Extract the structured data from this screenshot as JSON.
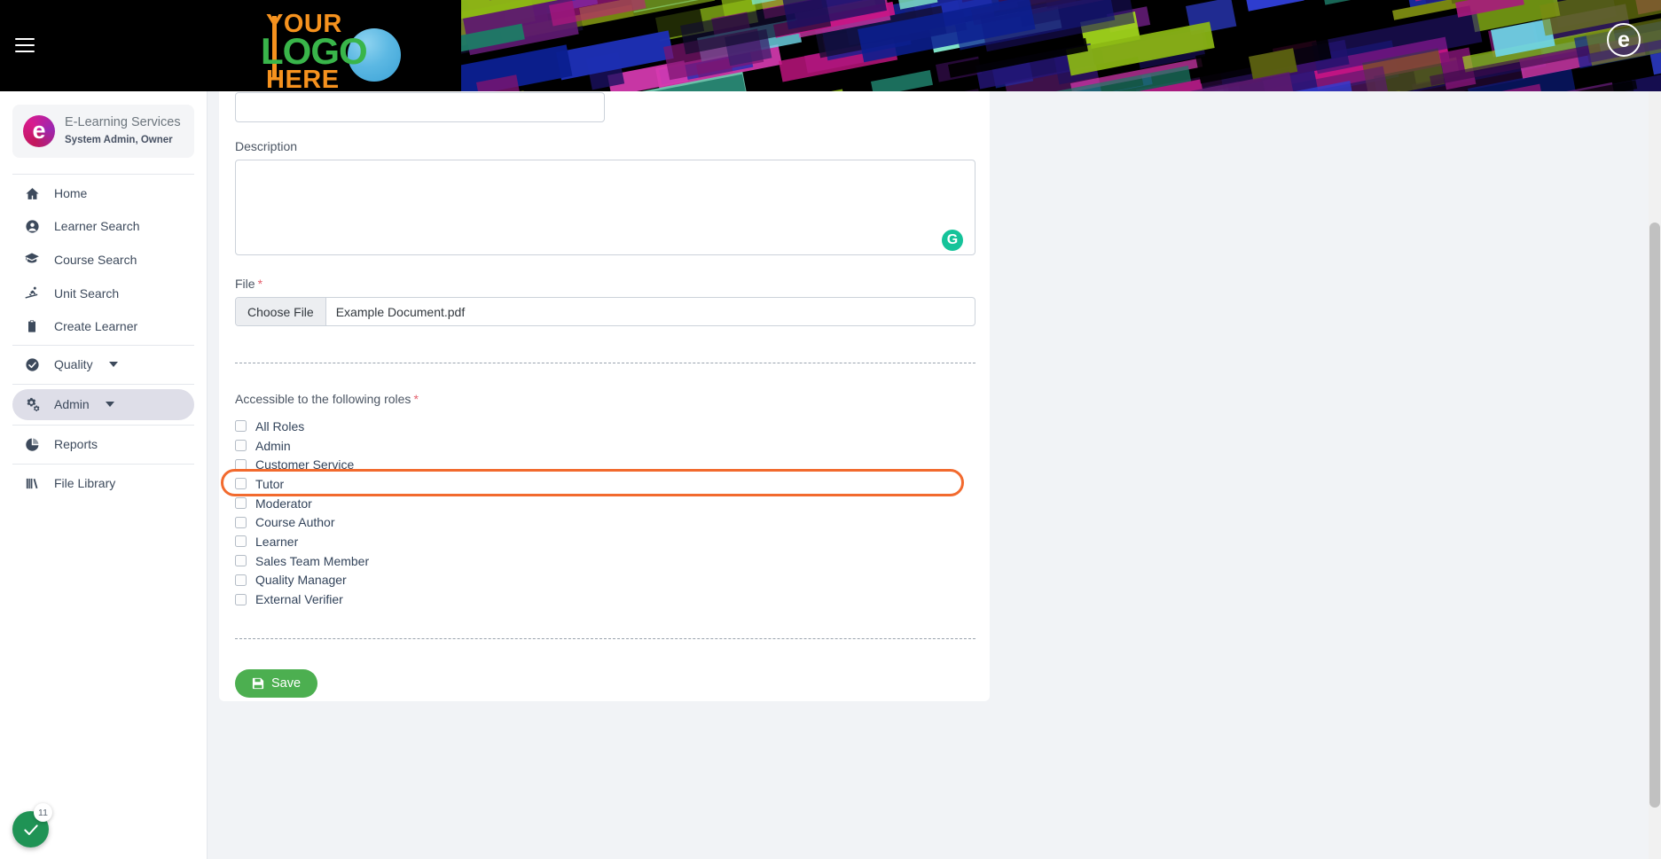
{
  "banner": {
    "menu_icon": "hamburger-menu-icon",
    "logo_line1": "YOUR",
    "logo_line2": "LOGO",
    "logo_line3": "HERE",
    "avatar_letter": "e",
    "bg_color": "#000000",
    "logo_orange": "#f6921e",
    "logo_green": "#39b54a",
    "logo_blue": "#5cb8e3"
  },
  "sidebar": {
    "profile": {
      "avatar_letter": "e",
      "name": "E-Learning Services",
      "role": "System Admin, Owner"
    },
    "items": [
      {
        "label": "Home",
        "icon": "home-icon",
        "has_caret": false,
        "active": false
      },
      {
        "label": "Learner Search",
        "icon": "user-circle-icon",
        "has_caret": false,
        "active": false
      },
      {
        "label": "Course Search",
        "icon": "graduate-icon",
        "has_caret": false,
        "active": false
      },
      {
        "label": "Unit Search",
        "icon": "skier-icon",
        "has_caret": false,
        "active": false
      },
      {
        "label": "Create Learner",
        "icon": "clipboard-list-icon",
        "has_caret": false,
        "active": false
      },
      {
        "label": "Quality",
        "icon": "check-circle-icon",
        "has_caret": true,
        "active": false
      },
      {
        "label": "Admin",
        "icon": "cogs-icon",
        "has_caret": true,
        "active": true
      },
      {
        "label": "Reports",
        "icon": "pie-chart-icon",
        "has_caret": false,
        "active": false
      },
      {
        "label": "File Library",
        "icon": "books-icon",
        "has_caret": false,
        "active": false
      }
    ]
  },
  "form": {
    "title_value": "",
    "title_placeholder": "",
    "description_label": "Description",
    "description_value": "",
    "description_placeholder": "",
    "grammarly_icon": "grammarly-g-icon",
    "file_label": "File",
    "file_required": "*",
    "choose_file_label": "Choose File",
    "file_name": "Example Document.pdf",
    "roles_label": "Accessible to the following roles",
    "roles_required": "*",
    "roles": [
      {
        "label": "All Roles",
        "checked": false
      },
      {
        "label": "Admin",
        "checked": false
      },
      {
        "label": "Customer Service",
        "checked": false
      },
      {
        "label": "Tutor",
        "checked": false
      },
      {
        "label": "Moderator",
        "checked": false
      },
      {
        "label": "Course Author",
        "checked": false
      },
      {
        "label": "Learner",
        "checked": false
      },
      {
        "label": "Sales Team Member",
        "checked": false
      },
      {
        "label": "Quality Manager",
        "checked": false
      },
      {
        "label": "External Verifier",
        "checked": false
      }
    ],
    "highlighted_role": "Tutor",
    "highlight_color": "#f26a2e",
    "save_label": "Save",
    "save_icon": "floppy-disk-icon",
    "save_color": "#4caf50"
  },
  "fab": {
    "icon": "check-icon",
    "badge_count": "11",
    "color": "#1f9355"
  }
}
